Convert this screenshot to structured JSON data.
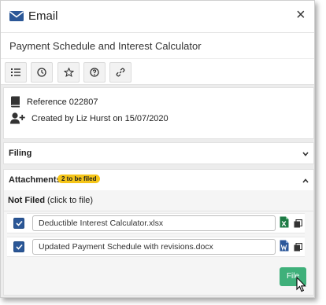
{
  "window": {
    "title": "Email",
    "close_symbol": "×"
  },
  "email": {
    "subject": "Payment Schedule and Interest Calculator"
  },
  "toolbar": {
    "buttons": [
      "list-icon",
      "clock-icon",
      "star-icon",
      "help-icon",
      "link-icon"
    ]
  },
  "details": {
    "reference": "Reference 022807",
    "created": "Created by Liz Hurst on 15/07/2020"
  },
  "sections": {
    "filing": {
      "label": "Filing",
      "expanded": false
    },
    "attachments": {
      "label": "Attachments",
      "badge": "2 to be filed",
      "expanded": true
    }
  },
  "not_filed": {
    "label": "Not Filed",
    "hint": "(click to file)"
  },
  "attachments": [
    {
      "name": "Deductible Interest Calculator.xlsx",
      "type": "excel",
      "checked": true
    },
    {
      "name": "Updated Payment Schedule with revisions.docx",
      "type": "word",
      "checked": true
    }
  ],
  "actions": {
    "file_label": "File"
  },
  "colors": {
    "accent_blue": "#2b5797",
    "file_button": "#3fb07a",
    "badge": "#f5c518",
    "excel_green": "#1d7a44",
    "word_blue": "#2b579a"
  }
}
